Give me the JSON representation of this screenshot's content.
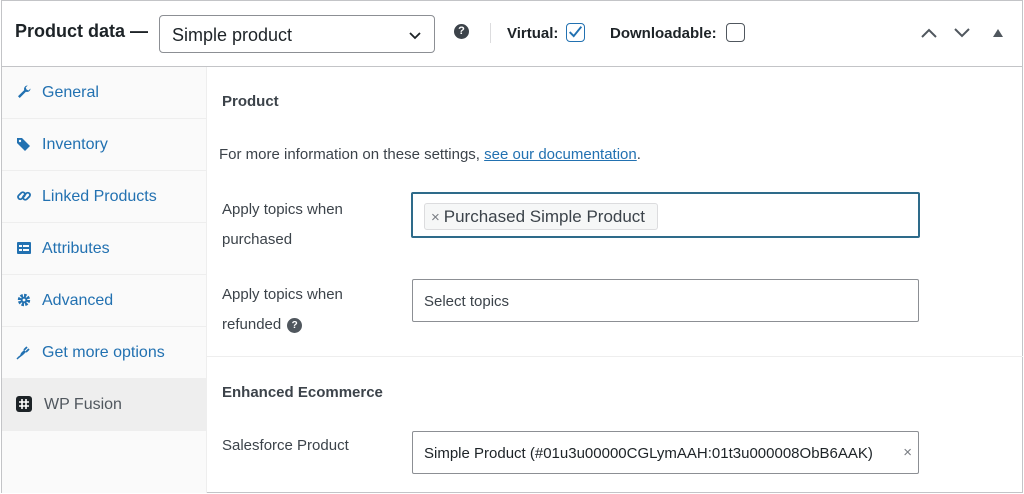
{
  "header": {
    "title": "Product data —",
    "product_type": "Simple product",
    "help_glyph": "?",
    "virtual_label": "Virtual:",
    "virtual_checked": true,
    "downloadable_label": "Downloadable:",
    "downloadable_checked": false
  },
  "sidebar": {
    "items": [
      {
        "label": "General",
        "icon": "wrench-icon"
      },
      {
        "label": "Inventory",
        "icon": "tag-icon"
      },
      {
        "label": "Linked Products",
        "icon": "link-icon"
      },
      {
        "label": "Attributes",
        "icon": "list-icon"
      },
      {
        "label": "Advanced",
        "icon": "gear-icon"
      },
      {
        "label": "Get more options",
        "icon": "plugin-icon"
      },
      {
        "label": "WP Fusion",
        "icon": "wpfusion-icon",
        "active": true
      }
    ]
  },
  "main": {
    "section_product": "Product",
    "info_text": "For more information on these settings,",
    "info_link": "see our documentation",
    "info_period": ".",
    "apply_purchased_label": "Apply topics when purchased",
    "apply_purchased_chip": "Purchased Simple Product",
    "chip_remove": "×",
    "apply_refunded_label": "Apply topics when refunded",
    "apply_refunded_placeholder": "Select topics",
    "section_ecommerce": "Enhanced Ecommerce",
    "salesforce_label": "Salesforce Product",
    "salesforce_value": "Simple Product (#01u3u00000CGLymAAH:01t3u000008ObB6AAK)",
    "salesforce_clear": "×"
  },
  "colors": {
    "link": "#2271b1",
    "focus_border": "#2e6b8a",
    "text": "#3c434a"
  }
}
